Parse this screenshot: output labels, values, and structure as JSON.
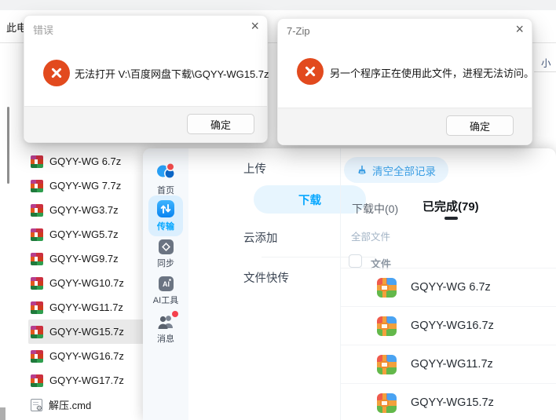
{
  "colors": {
    "accent": "#06a7ff",
    "error_icon": "#e24a1e"
  },
  "dialogs": [
    {
      "title": "错误",
      "message": "无法打开 V:\\百度网盘下载\\GQYY-WG15.7z",
      "ok_label": "确定",
      "close_glyph": "×"
    },
    {
      "title": "7-Zip",
      "message": "另一个程序正在使用此文件，进程无法访问。",
      "ok_label": "确定",
      "close_glyph": "×"
    }
  ],
  "explorer": {
    "breadcrumb_partial": "此电",
    "column_header_partial": "小",
    "files": [
      {
        "name": "GQYY-WG 6.7z",
        "icon": "winrar-archive-icon",
        "selected": false
      },
      {
        "name": "GQYY-WG 7.7z",
        "icon": "winrar-archive-icon",
        "selected": false
      },
      {
        "name": "GQYY-WG3.7z",
        "icon": "winrar-archive-icon",
        "selected": false
      },
      {
        "name": "GQYY-WG5.7z",
        "icon": "winrar-archive-icon",
        "selected": false
      },
      {
        "name": "GQYY-WG9.7z",
        "icon": "winrar-archive-icon",
        "selected": false
      },
      {
        "name": "GQYY-WG10.7z",
        "icon": "winrar-archive-icon",
        "selected": false
      },
      {
        "name": "GQYY-WG11.7z",
        "icon": "winrar-archive-icon",
        "selected": false
      },
      {
        "name": "GQYY-WG15.7z",
        "icon": "winrar-archive-icon",
        "selected": true
      },
      {
        "name": "GQYY-WG16.7z",
        "icon": "winrar-archive-icon",
        "selected": false
      },
      {
        "name": "GQYY-WG17.7z",
        "icon": "winrar-archive-icon",
        "selected": false
      },
      {
        "name": "解压.cmd",
        "icon": "cmd-script-icon",
        "selected": false
      }
    ]
  },
  "netdisk": {
    "nav": [
      {
        "label": "首页",
        "icon": "netdisk-logo-icon",
        "active": false
      },
      {
        "label": "传输",
        "icon": "transfer-icon",
        "active": true
      },
      {
        "label": "同步",
        "icon": "sync-icon",
        "active": false
      },
      {
        "label": "AI工具",
        "icon": "ai-tools-icon",
        "active": false
      },
      {
        "label": "消息",
        "icon": "messages-icon",
        "active": false,
        "badge": true
      }
    ],
    "menu": [
      {
        "label": "上传",
        "active": false
      },
      {
        "label": "下载",
        "active": true
      },
      {
        "label": "云添加",
        "active": false
      },
      {
        "label": "文件快传",
        "active": false
      }
    ],
    "downloads": {
      "clear_button": "清空全部记录",
      "tabs": [
        {
          "label": "下载中(0)",
          "active": false
        },
        {
          "label": "已完成(79)",
          "active": true
        }
      ],
      "filter": "全部文件",
      "list_header": "文件",
      "files": [
        "GQYY-WG 6.7z",
        "GQYY-WG16.7z",
        "GQYY-WG11.7z",
        "GQYY-WG15.7z"
      ]
    }
  }
}
